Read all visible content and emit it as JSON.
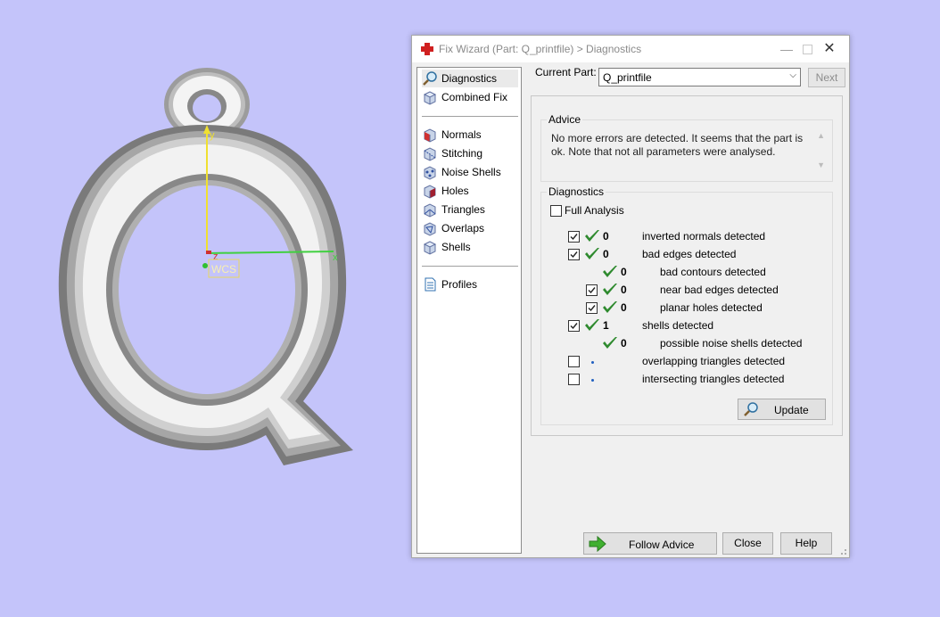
{
  "viewport": {
    "axis_labels": {
      "y": "y",
      "z": "z",
      "x": "x"
    },
    "wcs_label": "WCS"
  },
  "dialog": {
    "title": "Fix Wizard (Part: Q_printfile) > Diagnostics",
    "nav": [
      {
        "label": "Diagnostics",
        "icon": "magnifier-icon",
        "selected": true
      },
      {
        "label": "Combined Fix",
        "icon": "cube-icon"
      },
      {
        "label": "Normals",
        "icon": "normals-cube-icon"
      },
      {
        "label": "Stitching",
        "icon": "stitching-cube-icon"
      },
      {
        "label": "Noise Shells",
        "icon": "noise-shells-icon"
      },
      {
        "label": "Holes",
        "icon": "holes-cube-icon"
      },
      {
        "label": "Triangles",
        "icon": "triangles-cube-icon"
      },
      {
        "label": "Overlaps",
        "icon": "overlaps-cube-icon"
      },
      {
        "label": "Shells",
        "icon": "shells-cube-icon"
      },
      {
        "label": "Profiles",
        "icon": "document-icon"
      }
    ],
    "current_part_label": "Current Part:",
    "current_part_value": "Q_printfile",
    "next_label": "Next",
    "advice": {
      "title": "Advice",
      "text": "No more errors are detected. It seems that the part is ok. Note that not all parameters were analysed."
    },
    "diagnostics": {
      "title": "Diagnostics",
      "full_analysis_label": "Full Analysis",
      "full_analysis_checked": false,
      "rows": [
        {
          "checked": true,
          "status": "ok",
          "count": "0",
          "label": "inverted normals detected",
          "indent": 0
        },
        {
          "checked": true,
          "status": "ok",
          "count": "0",
          "label": "bad edges detected",
          "indent": 0
        },
        {
          "checkbox": false,
          "status": "ok",
          "count": "0",
          "label": "bad contours detected",
          "indent": 1
        },
        {
          "checked": true,
          "status": "ok",
          "count": "0",
          "label": "near bad edges detected",
          "indent": 1
        },
        {
          "checked": true,
          "status": "ok",
          "count": "0",
          "label": "planar holes detected",
          "indent": 1
        },
        {
          "checked": true,
          "status": "ok",
          "count": "1",
          "label": "shells detected",
          "indent": 0
        },
        {
          "checkbox": false,
          "status": "ok",
          "count": "0",
          "label": "possible noise shells detected",
          "indent": 1
        },
        {
          "checked": false,
          "status": "none",
          "count": "",
          "label": "overlapping triangles detected",
          "indent": 0
        },
        {
          "checked": false,
          "status": "none",
          "count": "",
          "label": "intersecting triangles detected",
          "indent": 0
        }
      ],
      "update_label": "Update"
    },
    "follow_advice_label": "Follow Advice",
    "close_label": "Close",
    "help_label": "Help"
  },
  "colors": {
    "background": "#c4c4fa",
    "check_green": "#2e8a2e",
    "axis_y": "#f0e030",
    "axis_x": "#40d040",
    "axis_z": "#d03030"
  }
}
